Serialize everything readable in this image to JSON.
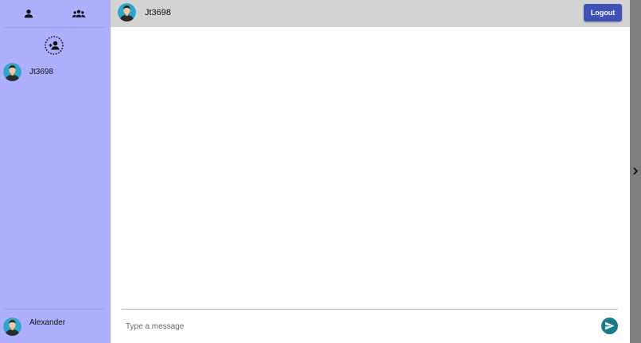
{
  "sidebar": {
    "tabs": [
      {
        "name": "person-icon",
        "label": "Contacts"
      },
      {
        "name": "group-icon",
        "label": "Groups"
      }
    ],
    "contacts": [
      {
        "name": "Jt3698"
      }
    ],
    "current_user": {
      "name": "Alexander"
    }
  },
  "header": {
    "contact_name": "Jt3698",
    "logout_label": "Logout"
  },
  "composer": {
    "placeholder": "Type a message",
    "value": ""
  },
  "colors": {
    "sidebar_bg": "#adaffd",
    "header_bg": "#d3d3d3",
    "logout_bg": "#3f51b5",
    "send_bg": "#1b7a8a",
    "rail_bg": "#7f7f7f"
  }
}
